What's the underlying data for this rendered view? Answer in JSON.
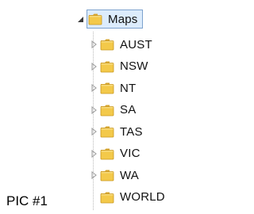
{
  "caption": "PIC #1",
  "colors": {
    "selection_bg": "#dcecfc",
    "selection_border": "#7da2ce",
    "folder_yellow": "#f3c94a",
    "folder_dark": "#d6a52c",
    "expander_gray": "#a0a0a0",
    "expander_dark": "#3c3c3c"
  },
  "tree": {
    "root": {
      "label": "Maps",
      "expanded": true,
      "selected": true,
      "icon": "folder-icon"
    },
    "children": [
      {
        "label": "AUST",
        "has_children": true,
        "icon": "folder-icon"
      },
      {
        "label": "NSW",
        "has_children": true,
        "icon": "folder-icon"
      },
      {
        "label": "NT",
        "has_children": true,
        "icon": "folder-icon"
      },
      {
        "label": "SA",
        "has_children": true,
        "icon": "folder-icon"
      },
      {
        "label": "TAS",
        "has_children": true,
        "icon": "folder-icon"
      },
      {
        "label": "VIC",
        "has_children": true,
        "icon": "folder-icon"
      },
      {
        "label": "WA",
        "has_children": true,
        "icon": "folder-icon"
      },
      {
        "label": "WORLD",
        "has_children": false,
        "icon": "folder-icon"
      }
    ]
  }
}
